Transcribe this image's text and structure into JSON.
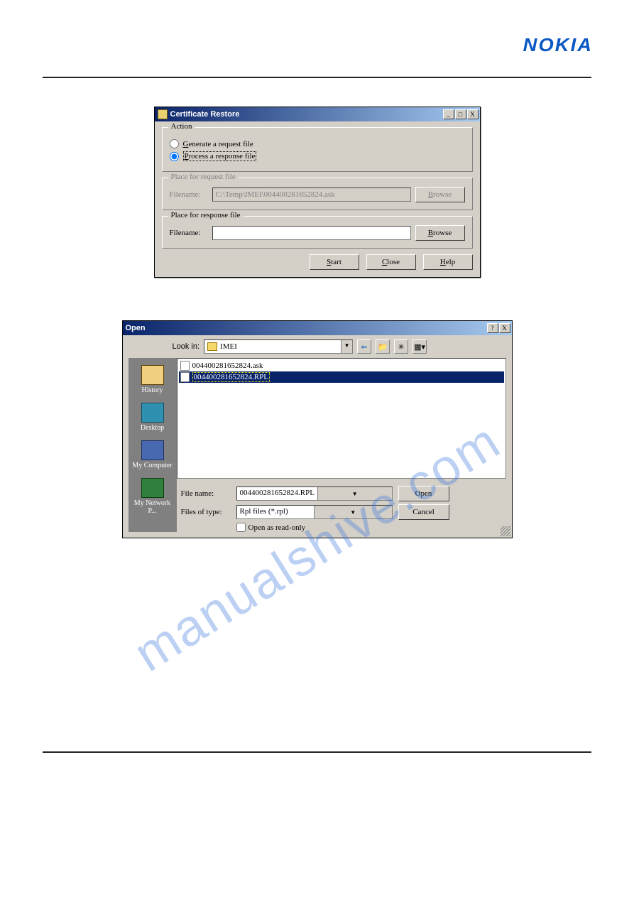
{
  "brand": "NOKIA",
  "watermark": "manualshive.com",
  "cert_restore": {
    "title": "Certificate Restore",
    "action_legend": "Action",
    "radio_generate": "Generate a request file",
    "radio_process": "Process a response file",
    "group_request_legend": "Place for request file",
    "group_response_legend": "Place for response file",
    "label_filename": "Filename:",
    "request_filename_value": "C:\\Temp\\IMEI\\004400281652824.ask",
    "response_filename_value": "",
    "btn_browse": "Browse",
    "btn_start": "Start",
    "btn_close": "Close",
    "btn_help": "Help"
  },
  "open_dialog": {
    "title": "Open",
    "lookin_label": "Look in:",
    "lookin_folder": "IMEI",
    "places": {
      "history": "History",
      "desktop": "Desktop",
      "mycomputer": "My Computer",
      "mynetwork": "My Network P..."
    },
    "files": [
      {
        "name": "004400281652824.ask",
        "selected": false
      },
      {
        "name": "004400281652824.RPL",
        "selected": true
      }
    ],
    "filename_label": "File name:",
    "filename_value": "004400281652824.RPL",
    "filetype_label": "Files of type:",
    "filetype_value": "Rpl files (*.rpl)",
    "readonly_label": "Open as read-only",
    "btn_open": "Open",
    "btn_cancel": "Cancel"
  }
}
